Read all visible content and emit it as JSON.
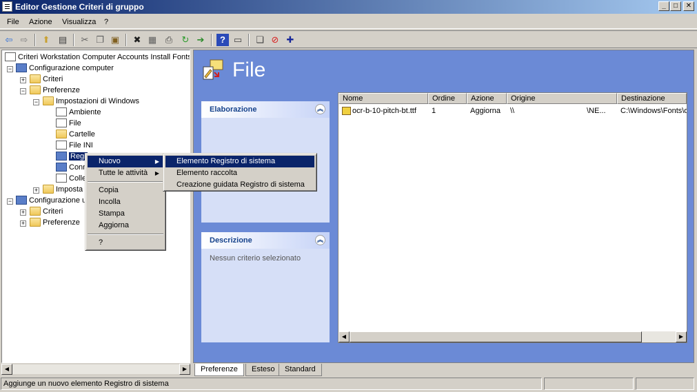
{
  "window": {
    "title": "Editor Gestione Criteri di gruppo"
  },
  "menu": [
    "File",
    "Azione",
    "Visualizza",
    "?"
  ],
  "tree": {
    "root": "Criteri Workstation Computer Accounts Install Fonts",
    "computer_config": "Configurazione computer",
    "criteri": "Criteri",
    "preferenze": "Preferenze",
    "impostazioni_windows": "Impostazioni di Windows",
    "ambiente": "Ambiente",
    "file": "File",
    "cartelle": "Cartelle",
    "file_ini": "File INI",
    "registro_partial": "Regi",
    "conn_partial": "Conn",
    "coll_partial": "Colle",
    "impostaz_partial": "Imposta",
    "user_config_partial": "Configurazione u",
    "user_criteri": "Criteri",
    "user_preferenze": "Preferenze"
  },
  "right_pane": {
    "title": "File",
    "elaborazione_header": "Elaborazione",
    "descrizione_header": "Descrizione",
    "descrizione_text": "Nessun criterio selezionato"
  },
  "list": {
    "columns": [
      "Nome",
      "Ordine",
      "Azione",
      "Origine",
      "Destinazione"
    ],
    "rows": [
      {
        "nome": "ocr-b-10-pitch-bt.ttf",
        "ordine": "1",
        "azione": "Aggiorna",
        "origine_a": "\\\\",
        "origine_b": "\\NE...",
        "destinazione": "C:\\Windows\\Fonts\\o"
      }
    ]
  },
  "context_menu": {
    "items": [
      "Nuovo",
      "Tutte le attività",
      "Copia",
      "Incolla",
      "Stampa",
      "Aggiorna",
      "?"
    ]
  },
  "submenu": {
    "items": [
      "Elemento Registro di sistema",
      "Elemento raccolta",
      "Creazione guidata Registro di sistema"
    ]
  },
  "tabs": [
    "Preferenze",
    "Esteso",
    "Standard"
  ],
  "status": {
    "text": "Aggiunge un nuovo elemento Registro di sistema"
  },
  "colors": {
    "title_start": "#0a246a",
    "title_end": "#a6caf0",
    "pane_bg": "#6b8ad6",
    "selection": "#0a246a"
  },
  "icons": [
    "back-icon",
    "forward-icon",
    "up-icon",
    "show-tree-icon",
    "cut-icon",
    "copy-icon",
    "paste-icon",
    "delete-icon",
    "properties-icon",
    "print-icon",
    "refresh-icon",
    "export-icon",
    "help-icon",
    "console-icon",
    "new-icon",
    "stop-icon",
    "add-icon"
  ]
}
